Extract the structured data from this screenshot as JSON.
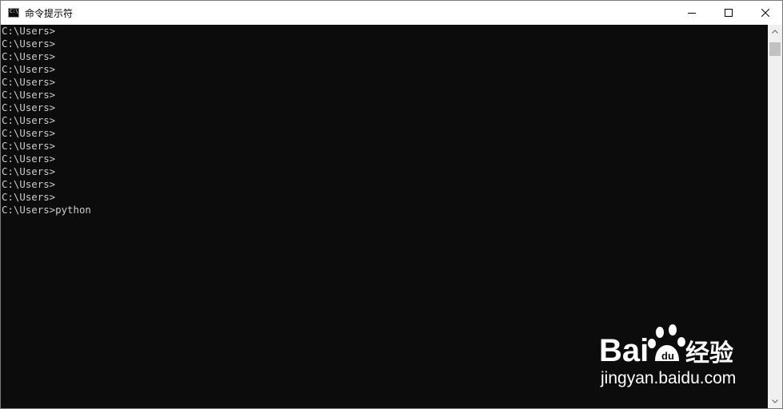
{
  "window": {
    "title": "命令提示符",
    "controls": [
      "minimize-icon",
      "maximize-icon",
      "close-icon"
    ]
  },
  "console": {
    "lines": [
      "C:\\Users>",
      "C:\\Users>",
      "C:\\Users>",
      "C:\\Users>",
      "C:\\Users>",
      "C:\\Users>",
      "C:\\Users>",
      "C:\\Users>",
      "C:\\Users>",
      "C:\\Users>",
      "C:\\Users>",
      "C:\\Users>",
      "C:\\Users>",
      "C:\\Users>",
      "C:\\Users>python"
    ]
  },
  "watermark": {
    "logo_text": "Bai经验",
    "url": "jingyan.baidu.com"
  },
  "colors": {
    "console_bg": "#0c0c0c",
    "console_fg": "#cccccc",
    "titlebar_bg": "#ffffff"
  }
}
